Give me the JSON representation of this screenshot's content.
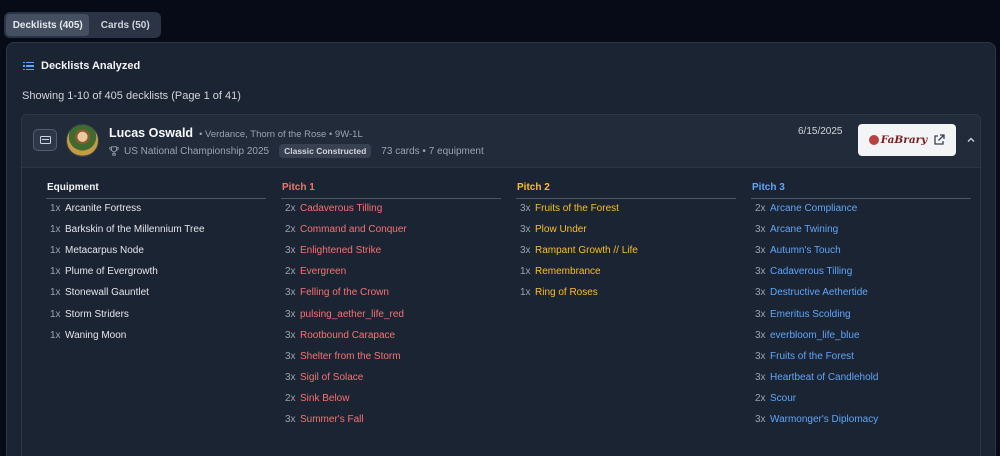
{
  "tabs": [
    {
      "label": "Decklists (405)",
      "active": true
    },
    {
      "label": "Cards (50)",
      "active": false
    }
  ],
  "panel": {
    "title": "Decklists Analyzed",
    "showing": "Showing 1-10 of 405 decklists (Page 1 of 41)"
  },
  "deck": {
    "player": "Lucas Oswald",
    "hero_line": "• Verdance, Thorn of the Rose • 9W-1L",
    "event": "US National Championship 2025",
    "format": "Classic Constructed",
    "card_count": "73 cards • 7 equipment",
    "date": "6/15/2025",
    "external_link": "FaBrary",
    "colors": {
      "pitch1": "#f87171",
      "pitch2": "#fbbf24",
      "pitch3": "#60a5fa"
    },
    "columns": {
      "equipment": {
        "title": "Equipment",
        "items": [
          {
            "qty": "1x",
            "name": "Arcanite Fortress"
          },
          {
            "qty": "1x",
            "name": "Barkskin of the Millennium Tree"
          },
          {
            "qty": "1x",
            "name": "Metacarpus Node"
          },
          {
            "qty": "1x",
            "name": "Plume of Evergrowth"
          },
          {
            "qty": "1x",
            "name": "Stonewall Gauntlet"
          },
          {
            "qty": "1x",
            "name": "Storm Striders"
          },
          {
            "qty": "1x",
            "name": "Waning Moon"
          }
        ]
      },
      "pitch1": {
        "title": "Pitch 1",
        "items": [
          {
            "qty": "2x",
            "name": "Cadaverous Tilling"
          },
          {
            "qty": "2x",
            "name": "Command and Conquer"
          },
          {
            "qty": "3x",
            "name": "Enlightened Strike"
          },
          {
            "qty": "2x",
            "name": "Evergreen"
          },
          {
            "qty": "3x",
            "name": "Felling of the Crown"
          },
          {
            "qty": "3x",
            "name": "pulsing_aether_life_red"
          },
          {
            "qty": "3x",
            "name": "Rootbound Carapace"
          },
          {
            "qty": "3x",
            "name": "Shelter from the Storm"
          },
          {
            "qty": "3x",
            "name": "Sigil of Solace"
          },
          {
            "qty": "2x",
            "name": "Sink Below"
          },
          {
            "qty": "3x",
            "name": "Summer's Fall"
          }
        ]
      },
      "pitch2": {
        "title": "Pitch 2",
        "items": [
          {
            "qty": "3x",
            "name": "Fruits of the Forest"
          },
          {
            "qty": "3x",
            "name": "Plow Under"
          },
          {
            "qty": "3x",
            "name": "Rampant Growth // Life"
          },
          {
            "qty": "1x",
            "name": "Remembrance"
          },
          {
            "qty": "1x",
            "name": "Ring of Roses"
          }
        ]
      },
      "pitch3": {
        "title": "Pitch 3",
        "items": [
          {
            "qty": "2x",
            "name": "Arcane Compliance"
          },
          {
            "qty": "3x",
            "name": "Arcane Twining"
          },
          {
            "qty": "3x",
            "name": "Autumn's Touch"
          },
          {
            "qty": "3x",
            "name": "Cadaverous Tilling"
          },
          {
            "qty": "3x",
            "name": "Destructive Aethertide"
          },
          {
            "qty": "3x",
            "name": "Emeritus Scolding"
          },
          {
            "qty": "3x",
            "name": "everbloom_life_blue"
          },
          {
            "qty": "3x",
            "name": "Fruits of the Forest"
          },
          {
            "qty": "3x",
            "name": "Heartbeat of Candlehold"
          },
          {
            "qty": "2x",
            "name": "Scour"
          },
          {
            "qty": "3x",
            "name": "Warmonger's Diplomacy"
          }
        ]
      }
    }
  }
}
